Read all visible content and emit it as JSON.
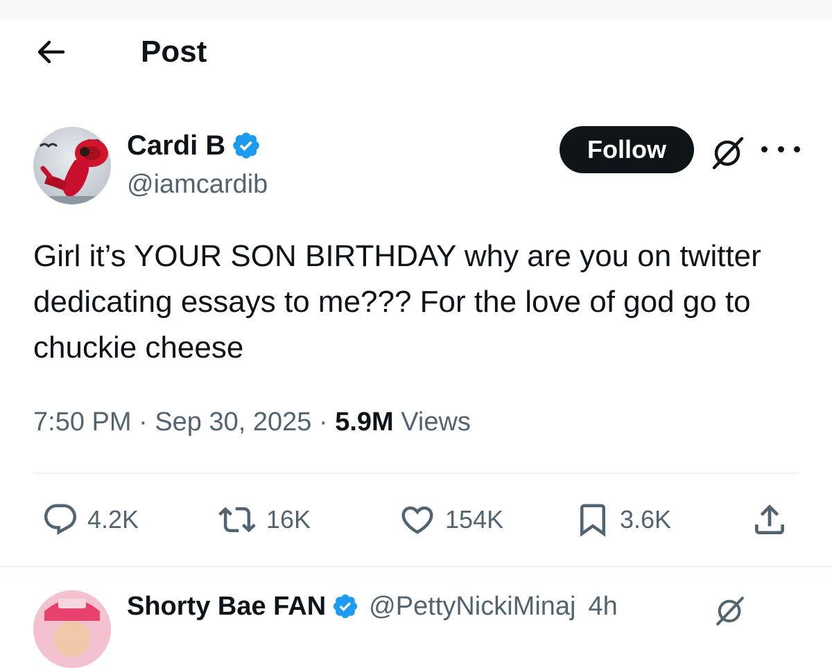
{
  "header": {
    "title": "Post",
    "back_icon": "arrow-left-icon"
  },
  "tweet": {
    "author_name": "Cardi B",
    "handle": "@iamcardib",
    "verified": true,
    "follow_label": "Follow",
    "text": "Girl it’s YOUR SON BIRTHDAY why are you on twitter dedicating essays to me??? For the love of god go to chuckie cheese",
    "time": "7:50 PM",
    "date": "Sep 30, 2025",
    "views_count": "5.9M",
    "views_label": "Views",
    "separator": "·"
  },
  "actions": {
    "replies": "4.2K",
    "reposts": "16K",
    "likes": "154K",
    "bookmarks": "3.6K"
  },
  "next_post": {
    "author_name": "Shorty Bae FAN",
    "handle": "@PettyNickiMinaj",
    "time": "4h"
  },
  "colors": {
    "text": "#0f1419",
    "secondary": "#536471",
    "verified": "#1d9bf0",
    "follow_bg": "#0f1419"
  }
}
